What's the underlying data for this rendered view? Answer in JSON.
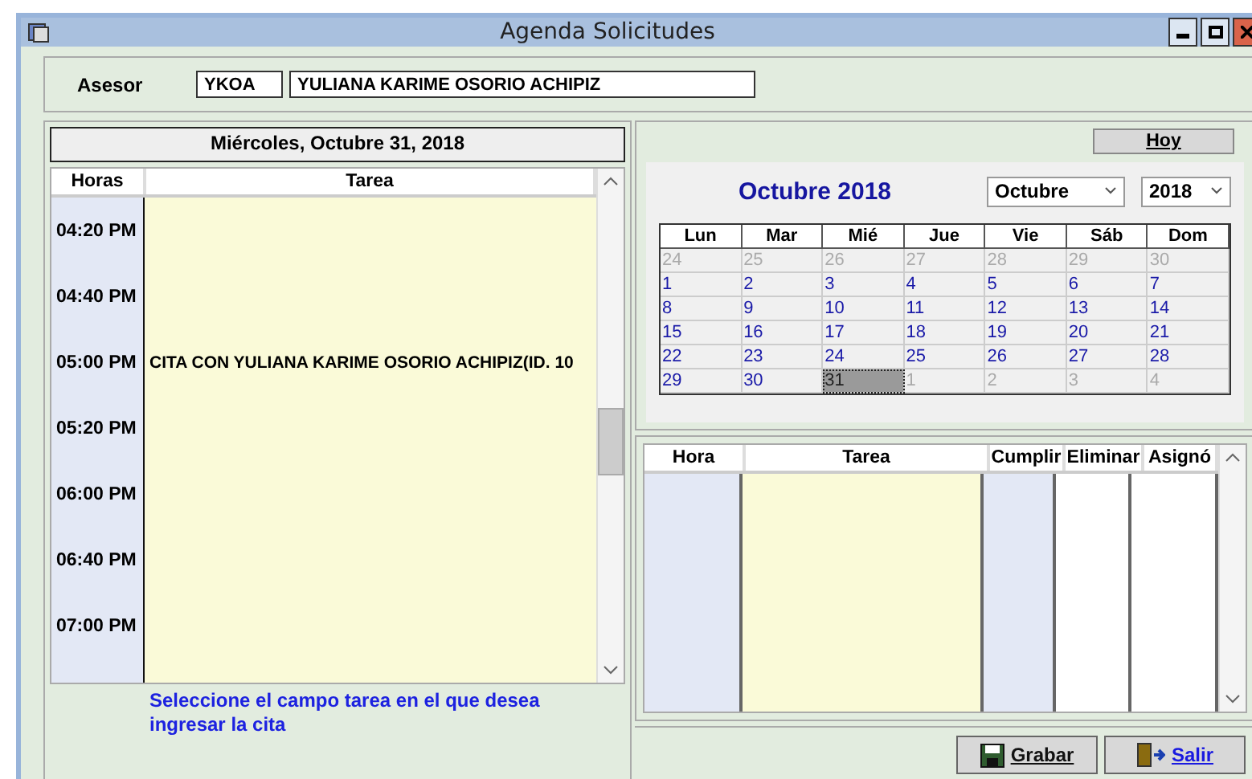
{
  "window": {
    "title": "Agenda Solicitudes"
  },
  "asesor": {
    "label": "Asesor",
    "code": "YKOA",
    "name": "YULIANA KARIME OSORIO ACHIPIZ"
  },
  "day_view": {
    "date": "Miércoles, Octubre 31, 2018",
    "columns": [
      "Horas",
      "Tarea"
    ],
    "rows": [
      {
        "time": "04:20 PM",
        "task": ""
      },
      {
        "time": "04:40 PM",
        "task": ""
      },
      {
        "time": "05:00 PM",
        "task": "CITA CON YULIANA KARIME OSORIO ACHIPIZ(ID. 10"
      },
      {
        "time": "05:20 PM",
        "task": ""
      },
      {
        "time": "06:00 PM",
        "task": ""
      },
      {
        "time": "06:40 PM",
        "task": ""
      },
      {
        "time": "07:00 PM",
        "task": ""
      }
    ],
    "hint": "Seleccione el campo tarea en el que desea ingresar la cita"
  },
  "calendar": {
    "today_button": "Hoy",
    "title": "Octubre 2018",
    "month_select": "Octubre",
    "year_select": "2018",
    "weekdays": [
      "Lun",
      "Mar",
      "Mié",
      "Jue",
      "Vie",
      "Sáb",
      "Dom"
    ],
    "weeks": [
      [
        {
          "day": "24",
          "other_month": true,
          "selected": false
        },
        {
          "day": "25",
          "other_month": true,
          "selected": false
        },
        {
          "day": "26",
          "other_month": true,
          "selected": false
        },
        {
          "day": "27",
          "other_month": true,
          "selected": false
        },
        {
          "day": "28",
          "other_month": true,
          "selected": false
        },
        {
          "day": "29",
          "other_month": true,
          "selected": false
        },
        {
          "day": "30",
          "other_month": true,
          "selected": false
        }
      ],
      [
        {
          "day": "1",
          "other_month": false,
          "selected": false
        },
        {
          "day": "2",
          "other_month": false,
          "selected": false
        },
        {
          "day": "3",
          "other_month": false,
          "selected": false
        },
        {
          "day": "4",
          "other_month": false,
          "selected": false
        },
        {
          "day": "5",
          "other_month": false,
          "selected": false
        },
        {
          "day": "6",
          "other_month": false,
          "selected": false
        },
        {
          "day": "7",
          "other_month": false,
          "selected": false
        }
      ],
      [
        {
          "day": "8",
          "other_month": false,
          "selected": false
        },
        {
          "day": "9",
          "other_month": false,
          "selected": false
        },
        {
          "day": "10",
          "other_month": false,
          "selected": false
        },
        {
          "day": "11",
          "other_month": false,
          "selected": false
        },
        {
          "day": "12",
          "other_month": false,
          "selected": false
        },
        {
          "day": "13",
          "other_month": false,
          "selected": false
        },
        {
          "day": "14",
          "other_month": false,
          "selected": false
        }
      ],
      [
        {
          "day": "15",
          "other_month": false,
          "selected": false
        },
        {
          "day": "16",
          "other_month": false,
          "selected": false
        },
        {
          "day": "17",
          "other_month": false,
          "selected": false
        },
        {
          "day": "18",
          "other_month": false,
          "selected": false
        },
        {
          "day": "19",
          "other_month": false,
          "selected": false
        },
        {
          "day": "20",
          "other_month": false,
          "selected": false
        },
        {
          "day": "21",
          "other_month": false,
          "selected": false
        }
      ],
      [
        {
          "day": "22",
          "other_month": false,
          "selected": false
        },
        {
          "day": "23",
          "other_month": false,
          "selected": false
        },
        {
          "day": "24",
          "other_month": false,
          "selected": false
        },
        {
          "day": "25",
          "other_month": false,
          "selected": false
        },
        {
          "day": "26",
          "other_month": false,
          "selected": false
        },
        {
          "day": "27",
          "other_month": false,
          "selected": false
        },
        {
          "day": "28",
          "other_month": false,
          "selected": false
        }
      ],
      [
        {
          "day": "29",
          "other_month": false,
          "selected": false
        },
        {
          "day": "30",
          "other_month": false,
          "selected": false
        },
        {
          "day": "31",
          "other_month": false,
          "selected": true
        },
        {
          "day": "1",
          "other_month": true,
          "selected": false
        },
        {
          "day": "2",
          "other_month": true,
          "selected": false
        },
        {
          "day": "3",
          "other_month": true,
          "selected": false
        },
        {
          "day": "4",
          "other_month": true,
          "selected": false
        }
      ]
    ]
  },
  "task_list": {
    "columns": [
      "Hora",
      "Tarea",
      "Cumplir",
      "Eliminar",
      "Asignó"
    ]
  },
  "buttons": [
    {
      "kind": "save",
      "label": "Grabar"
    },
    {
      "kind": "exit",
      "label": "Salir"
    }
  ]
}
